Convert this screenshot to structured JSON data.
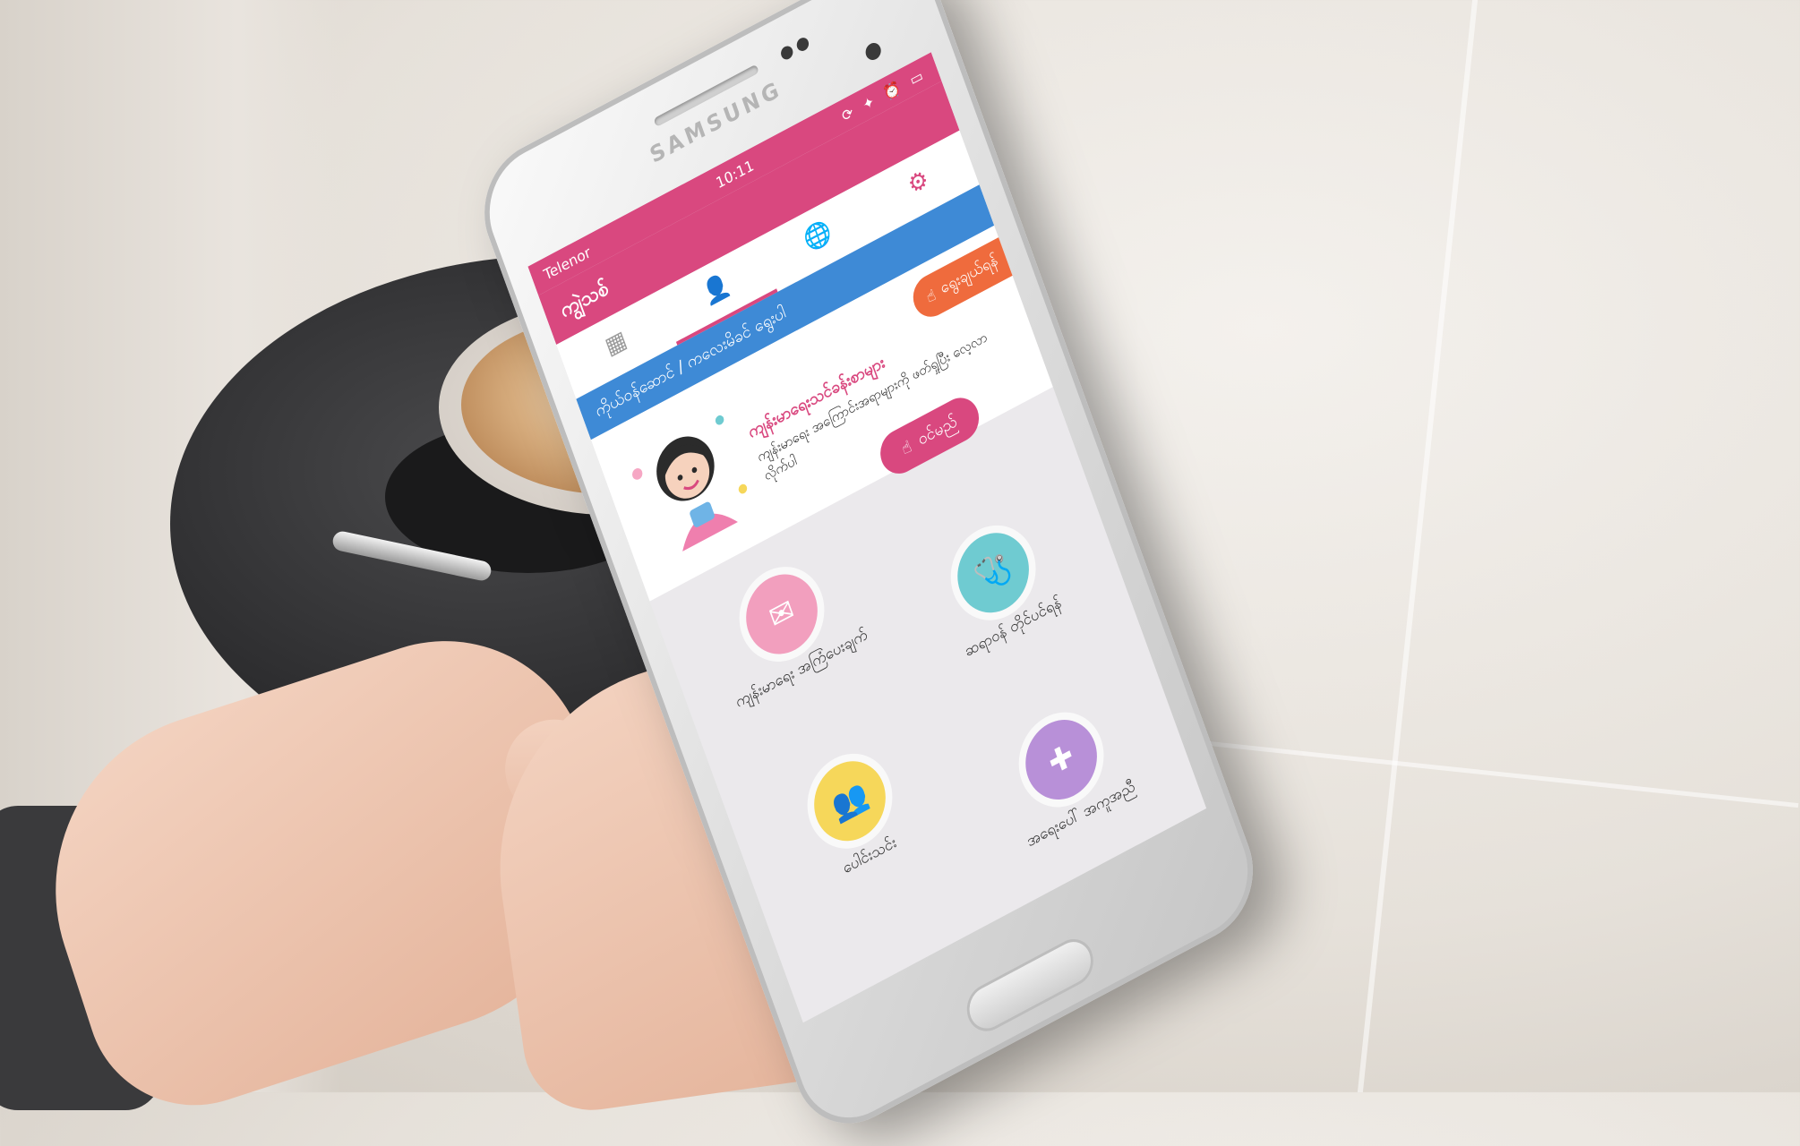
{
  "device": {
    "brand": "SAMSUNG"
  },
  "status_bar": {
    "carrier": "Telenor",
    "carrier_icons": "signal-and-music-icons",
    "time": "10:11",
    "right_icons": "sync-bluetooth-alarm-battery-icons"
  },
  "app_bar": {
    "title": "ကျွဲသစ်"
  },
  "tabs": [
    {
      "icon": "calendar-icon",
      "glyph": "▦"
    },
    {
      "icon": "person-icon",
      "glyph": "👤"
    },
    {
      "icon": "globe-icon",
      "glyph": "🌐"
    },
    {
      "icon": "gear-icon",
      "glyph": "⚙"
    }
  ],
  "date_banner": {
    "text": "ကိုယ်ဝန်ဆောင် / ကလေးမိခင် ရွေးပါ"
  },
  "welcome": {
    "choose_label": "ရွေးချယ်ရန်",
    "title": "ကျန်းမာရေးသင်ခန်းစာများ",
    "body": "ကျန်းမာရေး အကြောင်းအရာများကို ဖတ်ရှုပြီး လေ့လာလိုက်ပါ",
    "login_label": "ဝင်မည်"
  },
  "menu": [
    {
      "icon": "envelope-icon",
      "glyph": "✉",
      "color": "#f29fbe",
      "label": "ကျန်းမာရေး အကြံပေးချက်"
    },
    {
      "icon": "doctor-icon",
      "glyph": "🩺",
      "color": "#6fcbd1",
      "label": "ဆရာဝန် တိုင်ပင်ရန်"
    },
    {
      "icon": "community-icon",
      "glyph": "👥",
      "color": "#f6d75a",
      "label": "ပေါင်းသင်း"
    },
    {
      "icon": "emergency-book-icon",
      "glyph": "✚",
      "color": "#b890d8",
      "label": "အရေးပေါ် အကူအညီ"
    }
  ],
  "colors": {
    "brand_pink": "#d9487f",
    "banner_blue": "#3e8ad6",
    "choose_orange": "#ef6b3d"
  }
}
